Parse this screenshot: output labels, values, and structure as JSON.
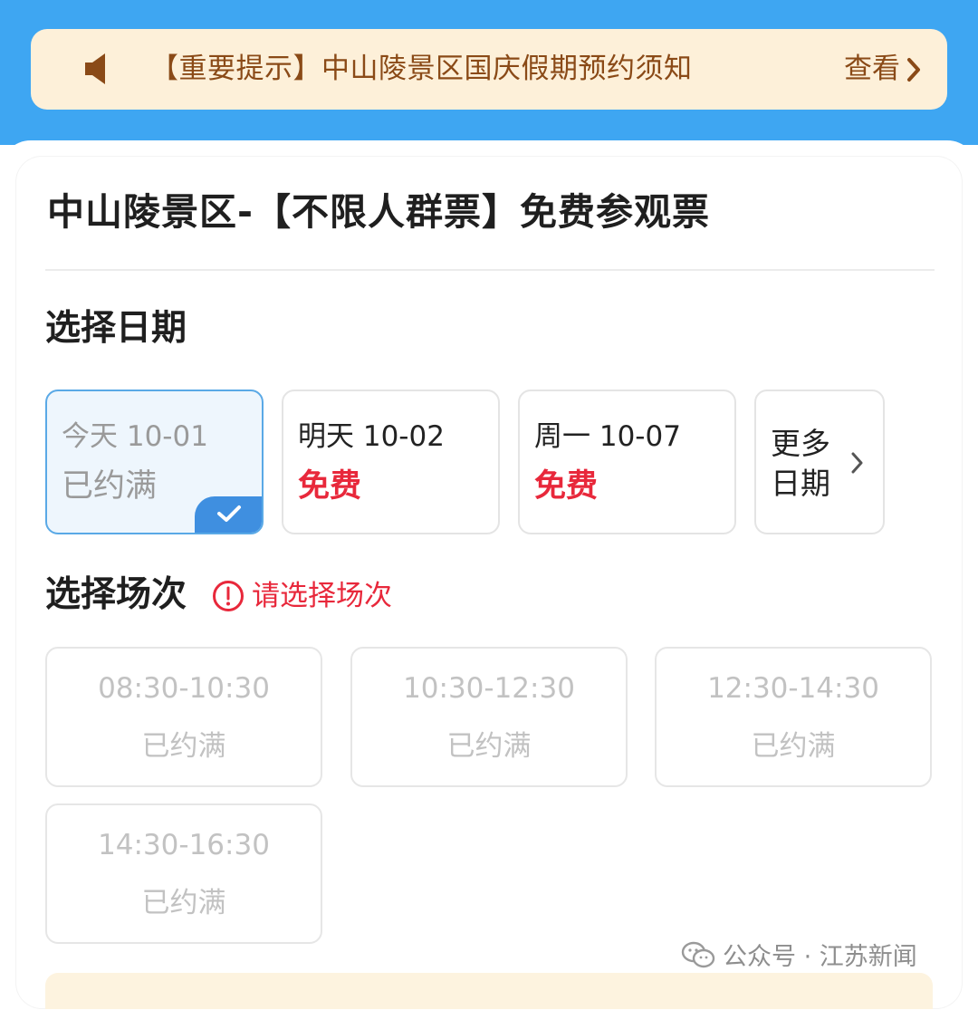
{
  "notice": {
    "text": "【重要提示】中山陵景区国庆假期预约须知",
    "link_label": "查看",
    "icon": "speaker-icon"
  },
  "ticket": {
    "title": "中山陵景区-【不限人群票】免费参观票"
  },
  "date_section": {
    "label": "选择日期",
    "dates": [
      {
        "label": "今天 10-01",
        "status": "已约满",
        "selected": true
      },
      {
        "label": "明天 10-02",
        "status": "免费",
        "selected": false
      },
      {
        "label": "周一 10-07",
        "status": "免费",
        "selected": false
      }
    ],
    "more_label": "更多日期"
  },
  "session_section": {
    "label": "选择场次",
    "warning": "请选择场次",
    "slots": [
      {
        "time": "08:30-10:30",
        "status": "已约满"
      },
      {
        "time": "10:30-12:30",
        "status": "已约满"
      },
      {
        "time": "12:30-14:30",
        "status": "已约满"
      },
      {
        "time": "14:30-16:30",
        "status": "已约满"
      }
    ]
  },
  "watermark": {
    "text": "公众号 · 江苏新闻"
  },
  "colors": {
    "header_blue": "#3ea6f2",
    "notice_bg": "#fdf0d9",
    "notice_text": "#8a4a17",
    "free_red": "#e8283b",
    "selected_border": "#5aa9e6",
    "check_blue": "#3f8fe0"
  }
}
